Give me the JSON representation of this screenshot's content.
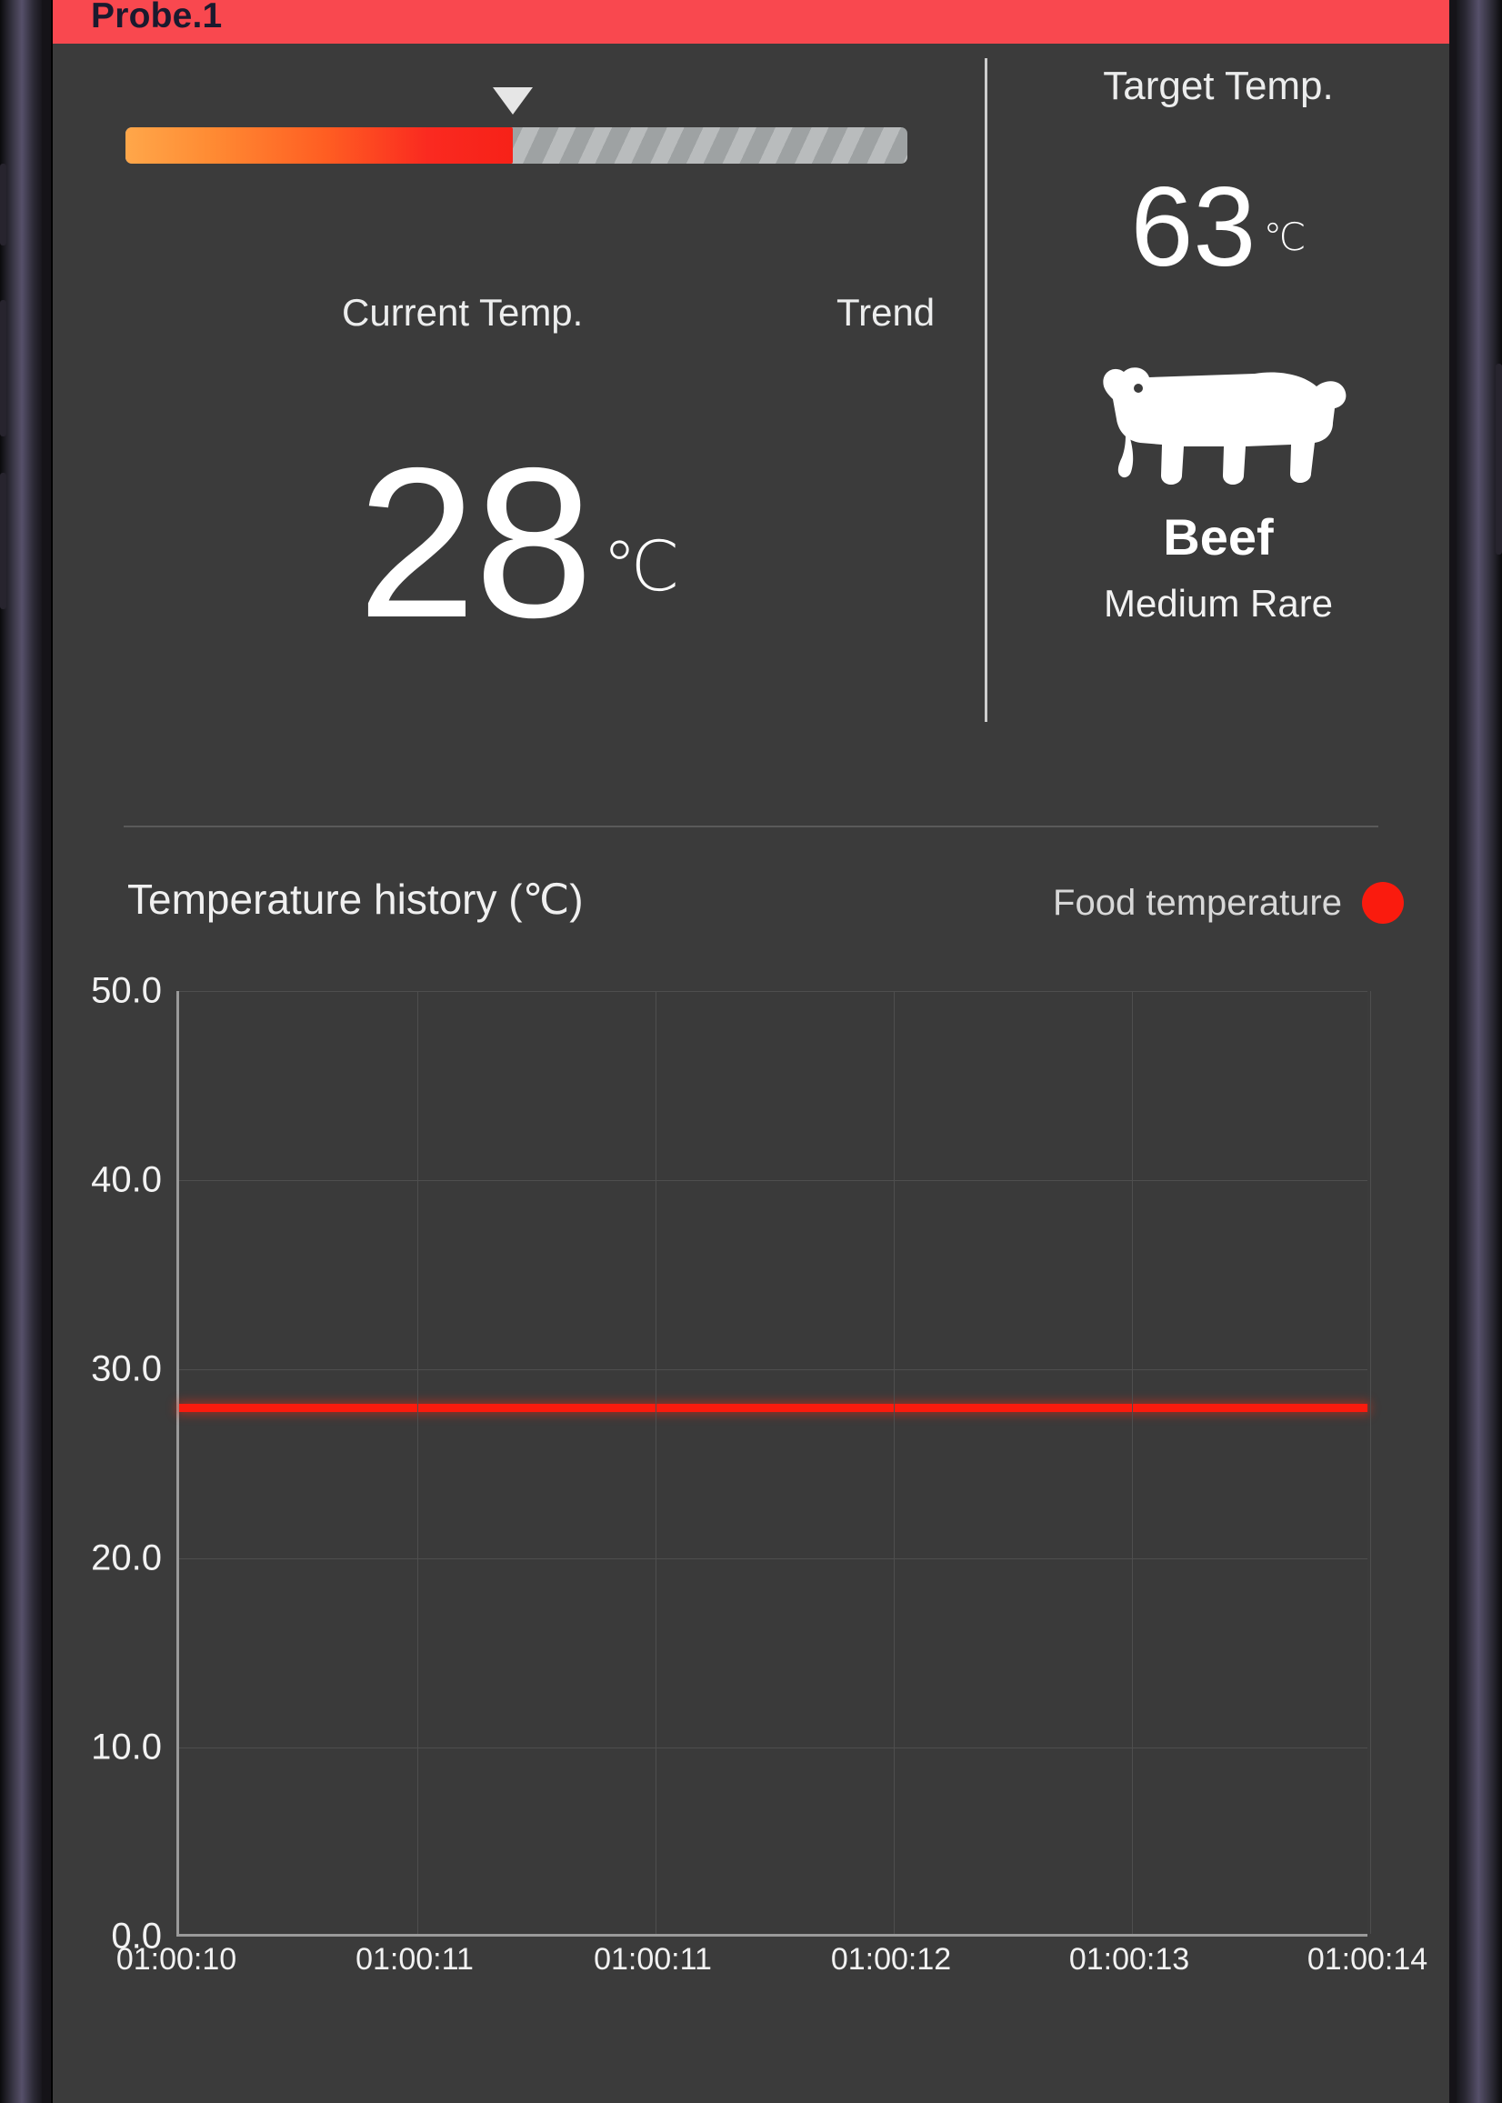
{
  "probe": {
    "title": "Probe.1",
    "header_color": "#f9484f"
  },
  "current": {
    "label": "Current Temp.",
    "value": "28",
    "unit": "℃",
    "progress_percent": 49.5,
    "trend_label": "Trend"
  },
  "target": {
    "label": "Target Temp.",
    "value": "63",
    "unit": "℃"
  },
  "food": {
    "icon": "cow-icon",
    "name": "Beef",
    "doneness": "Medium Rare"
  },
  "chart_header": {
    "title": "Temperature history (℃)",
    "legend_label": "Food temperature",
    "legend_color": "#fa1b0e",
    "legend_icon": "legend-dot-icon"
  },
  "chart_data": {
    "type": "line",
    "title": "Temperature history (℃)",
    "xlabel": "",
    "ylabel": "℃",
    "ylim": [
      0,
      50
    ],
    "yticks": [
      "50.0",
      "40.0",
      "30.0",
      "20.0",
      "10.0",
      "0.0"
    ],
    "ytick_values": [
      50,
      40,
      30,
      20,
      10,
      0
    ],
    "grid": true,
    "legend_position": "top-right",
    "x": [
      "01:00:10",
      "01:00:11",
      "01:00:11",
      "01:00:12",
      "01:00:13",
      "01:00:14"
    ],
    "series": [
      {
        "name": "Food temperature",
        "color": "#fa1b0e",
        "values": [
          28,
          28,
          28,
          28,
          28,
          28
        ]
      }
    ]
  }
}
